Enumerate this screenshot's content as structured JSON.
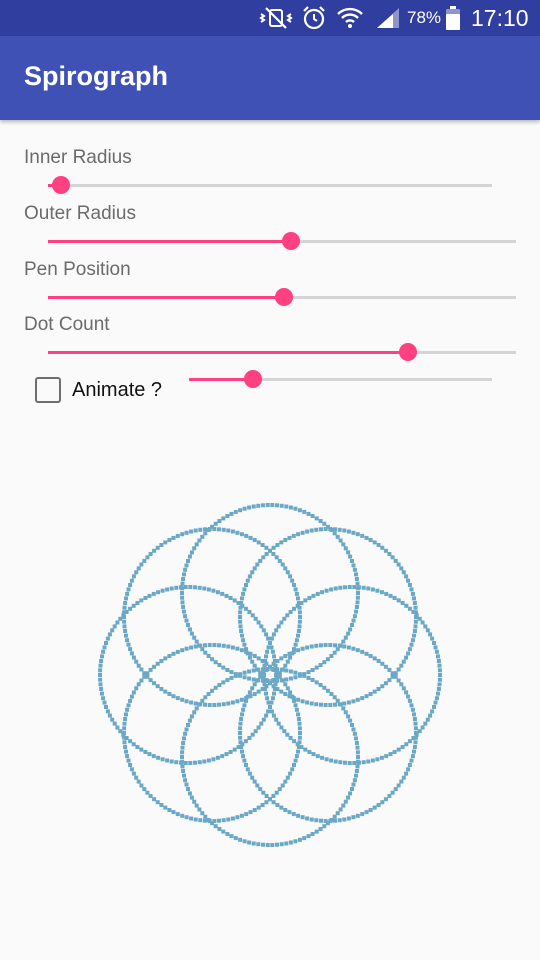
{
  "status_bar": {
    "battery_percent": "78%",
    "time": "17:10",
    "icons": [
      "vibrate-mute-icon",
      "alarm-icon",
      "wifi-icon",
      "signal-icon",
      "battery-icon"
    ]
  },
  "app_bar": {
    "title": "Spirograph"
  },
  "controls": {
    "inner_radius": {
      "label": "Inner Radius",
      "value": 0.03
    },
    "outer_radius": {
      "label": "Outer Radius",
      "value": 0.52
    },
    "pen_position": {
      "label": "Pen Position",
      "value": 0.505
    },
    "dot_count": {
      "label": "Dot Count",
      "value": 0.77
    },
    "animate": {
      "label": "Animate ?",
      "checked": false,
      "speed_value": 0.21
    }
  },
  "drawing": {
    "dot_color": "#6aa8c6",
    "petals": 8
  },
  "colors": {
    "primary": "#3f51b5",
    "primary_dark": "#303f9f",
    "accent": "#ff4081"
  }
}
